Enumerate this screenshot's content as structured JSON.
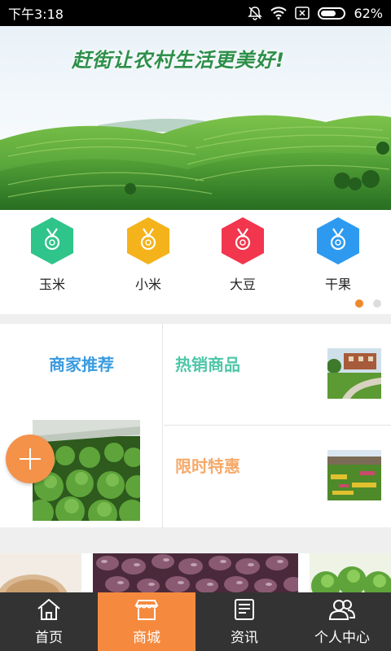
{
  "status_bar": {
    "time": "下午3:18",
    "battery": "62%",
    "icons": [
      "mute-bell-icon",
      "wifi-icon",
      "sim-off-icon",
      "battery-icon"
    ]
  },
  "banner": {
    "slogan": "赶街让农村生活更美好!"
  },
  "categories": {
    "items": [
      {
        "label": "玉米",
        "color": "#2fc48a",
        "icon": "medal-icon"
      },
      {
        "label": "小米",
        "color": "#f5b31b",
        "icon": "medal-icon"
      },
      {
        "label": "大豆",
        "color": "#f1364d",
        "icon": "medal-icon"
      },
      {
        "label": "干果",
        "color": "#2d9af0",
        "icon": "medal-icon"
      }
    ],
    "pager": {
      "count": 2,
      "active": 0
    }
  },
  "featured": {
    "merchant_title": "商家推荐",
    "hot_title": "热销商品",
    "limited_title": "限时特惠"
  },
  "fab": {
    "icon": "plus-icon"
  },
  "bottom_nav": {
    "items": [
      {
        "label": "首页",
        "icon": "home-icon"
      },
      {
        "label": "商城",
        "icon": "shop-icon",
        "active": true
      },
      {
        "label": "资讯",
        "icon": "news-icon"
      },
      {
        "label": "个人中心",
        "icon": "users-icon"
      }
    ]
  },
  "colors": {
    "accent": "#f58a3f",
    "nav_bg": "#333333",
    "merchant": "#3a9be0",
    "hot": "#4fc6a8",
    "limited": "#f6a969"
  }
}
